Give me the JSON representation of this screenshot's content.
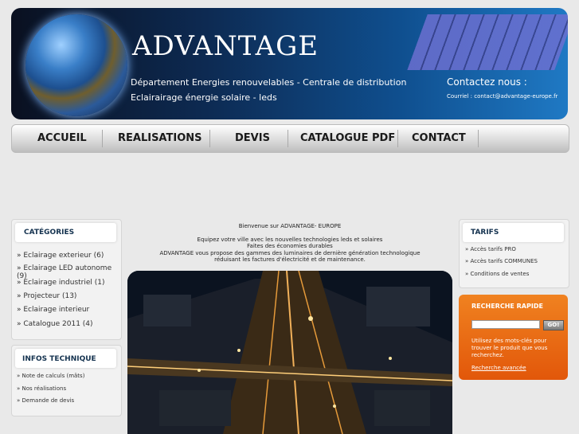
{
  "banner": {
    "brand": "ADVANTAGE",
    "subtitle_line1": "Département Energies renouvelables - Centrale de distribution",
    "subtitle_line2": "Eclairairage énergie solaire - leds",
    "contact_title": "Contactez nous :",
    "contact_email": "Courriel : contact@advantage-europe.fr"
  },
  "nav": {
    "items": [
      "ACCUEIL",
      "REALISATIONS",
      "DEVIS",
      "CATALOGUE PDF",
      "CONTACT"
    ]
  },
  "categories": {
    "title": "CATÉGORIES",
    "items": [
      "» Eclairage exterieur (6)",
      "» Eclairage LED autonome (9)",
      "» Eclairage industriel (1)",
      "» Projecteur (13)",
      "» Eclairage interieur",
      "» Catalogue 2011 (4)"
    ]
  },
  "infos": {
    "title": "INFOS TECHNIQUE",
    "items": [
      "» Note de calculs (mâts)",
      "» Nos réalisations",
      "» Demande de devis"
    ]
  },
  "main": {
    "welcome": "Bienvenue sur ADVANTAGE- EUROPE",
    "line1": "Equipez votre ville avec les nouvelles technologies leds et solaires",
    "line2": "Faites des économies durables",
    "line3": "ADVANTAGE vous propose des gammes des luminaires de dernière génération technologique",
    "line4": "réduisant les factures d'électricité et de maintenance."
  },
  "tarifs": {
    "title": "TARIFS",
    "items": [
      "» Accès tarifs PRO",
      "» Accès tarifs COMMUNES",
      "» Conditions de ventes"
    ]
  },
  "search": {
    "title": "RECHERCHE RAPIDE",
    "go_label": "GO!",
    "input_value": "",
    "help_text": "Utilisez des mots-clés pour trouver le produit que vous recherchez.",
    "advanced_link": "Recherche avancée"
  }
}
